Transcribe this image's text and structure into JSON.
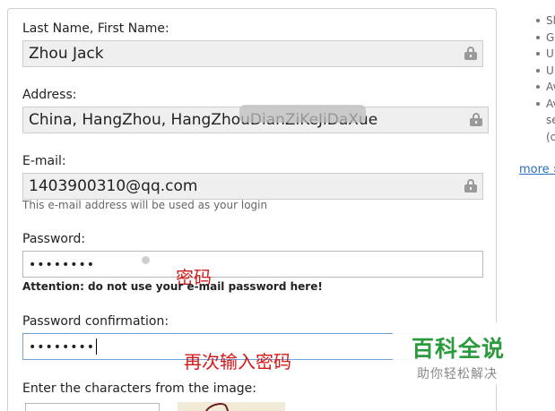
{
  "form": {
    "name": {
      "label": "Last Name, First Name:",
      "value": "Zhou Jack"
    },
    "address": {
      "label": "Address:",
      "value": "China, HangZhou, HangZhouDianZiKeJiDaXue"
    },
    "email": {
      "label": "E-mail:",
      "value": "1403900310@qq.com",
      "hint": "This e-mail address will be used as your login"
    },
    "password": {
      "label": "Password:",
      "value": "••••••••",
      "warning": "Attention: do not use your e-mail password here!"
    },
    "password_confirm": {
      "label": "Password confirmation:",
      "value": "••••••••"
    },
    "captcha": {
      "label": "Enter the characters from the image:"
    }
  },
  "annotations": {
    "password": "密码",
    "password_confirm": "再次输入密码"
  },
  "sidebar": {
    "items": [
      "Sl",
      "G",
      "U",
      "U",
      "Av",
      "Av",
      "se",
      "(c"
    ],
    "more_link": "more ›"
  },
  "watermark": {
    "title": "百科全说",
    "subtitle": "助你轻松解决"
  },
  "colors": {
    "annotation": "#d21a1a",
    "watermark_green": "#2a9a3c",
    "focus_border": "#6fa3d8"
  }
}
